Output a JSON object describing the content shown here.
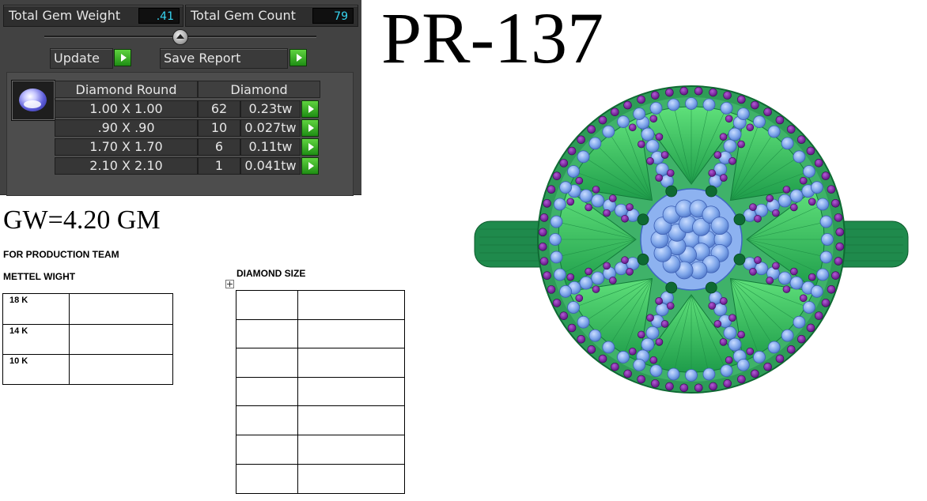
{
  "gem_panel": {
    "total_gem_weight_label": "Total Gem Weight",
    "total_gem_weight_value": ".41",
    "total_gem_count_label": "Total Gem Count",
    "total_gem_count_value": "79",
    "update_label": "Update",
    "save_report_label": "Save Report",
    "table": {
      "header_shape": "Diamond Round",
      "header_type": "Diamond",
      "rows": [
        {
          "size": "1.00 X 1.00",
          "count": "62",
          "weight": "0.23tw"
        },
        {
          "size": ".90 X .90",
          "count": "10",
          "weight": "0.027tw"
        },
        {
          "size": "1.70 X 1.70",
          "count": "6",
          "weight": "0.11tw"
        },
        {
          "size": "2.10 X 2.10",
          "count": "1",
          "weight": "0.041tw"
        }
      ]
    },
    "icons": {
      "gem_thumbnail": "round-diamond-icon",
      "row_action": "green-play-arrow-icon"
    }
  },
  "model_code": "PR-137",
  "gold_weight": "GW=4.20 GM",
  "production": {
    "team_label": "FOR PRODUCTION TEAM",
    "metal_weight_label": "METTEL WIGHT",
    "metal_rows": [
      "18 K",
      "14 K",
      "10 K"
    ],
    "diamond_size_label": "DIAMOND SIZE"
  },
  "colors": {
    "panel_bg": "#424242",
    "value_text": "#37d6f2",
    "go_button": "#3fb52a",
    "ring_metal": "#2f9e5a",
    "ring_stone_blue": "#7ea6ea",
    "ring_stone_purple": "#7a1f9c"
  }
}
